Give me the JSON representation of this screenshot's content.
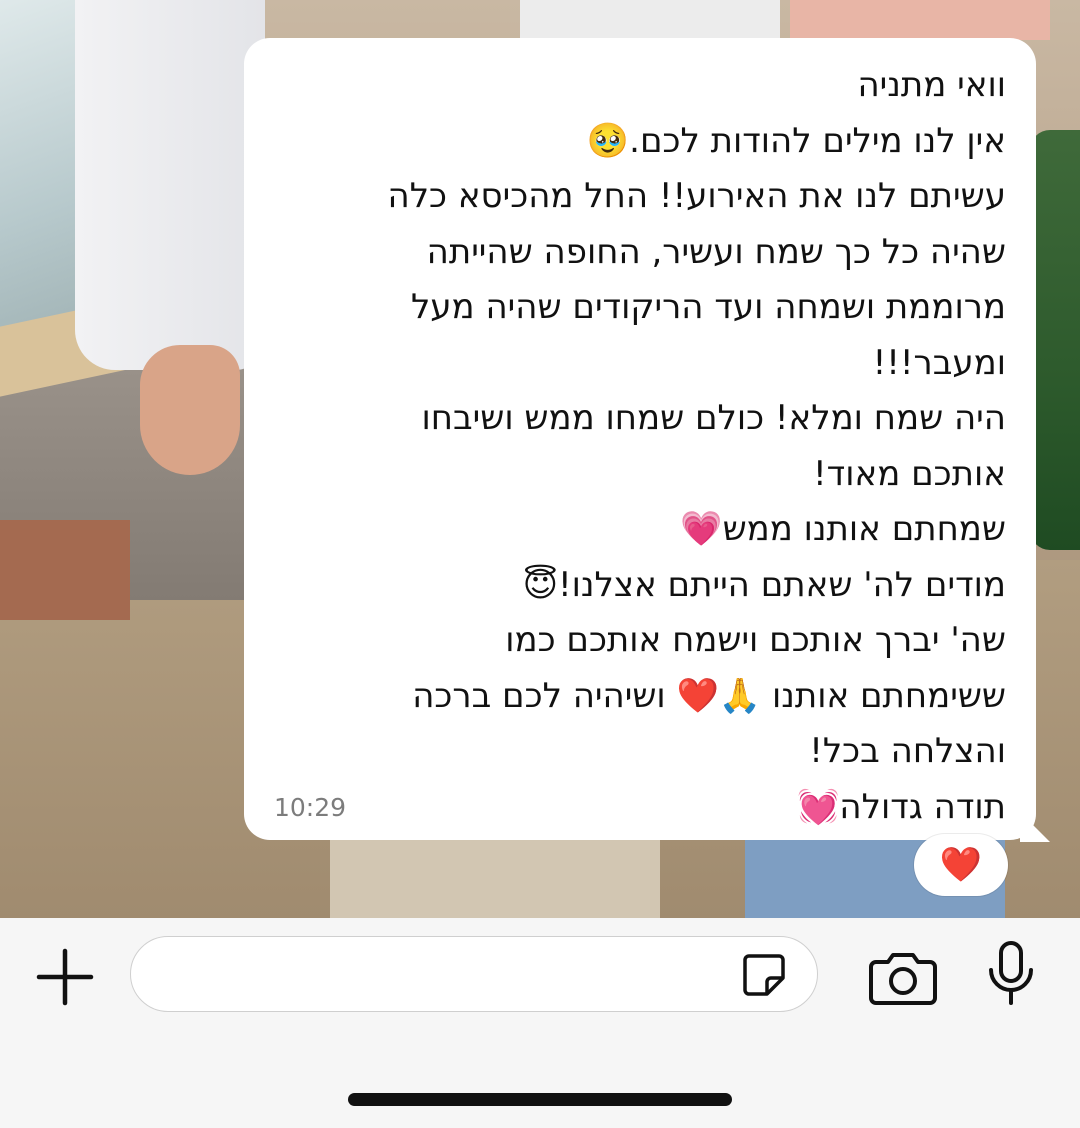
{
  "message": {
    "lines": [
      "וואי מתניה",
      "אין לנו מילים להודות לכם.🥹",
      "עשיתם לנו את האירוע!! החל מהכיסא כלה",
      "שהיה כל כך שמח ועשיר, החופה שהייתה",
      "מרוממת ושמחה ועד הריקודים שהיה מעל",
      "ומעבר!!!",
      "היה שמח ומלא! כולם שמחו ממש ושיבחו",
      "אותכם מאוד!",
      "שמחתם אותנו ממש💗",
      "מודים לה' שאתם הייתם אצלנו!😇",
      "שה' יברך אותכם וישמח אותכם כמו",
      "ששימחתם אותנו 🙏❤️ ושיהיה לכם ברכה",
      "והצלחה בכל!",
      "תודה גדולה💓"
    ],
    "time": "10:29"
  },
  "reaction": {
    "emoji": "❤️"
  },
  "composer": {
    "input_value": "",
    "icons": {
      "plus": "plus-icon",
      "sticker": "sticker-icon",
      "camera": "camera-icon",
      "mic": "microphone-icon"
    }
  },
  "colors": {
    "bubble": "#ffffff",
    "text": "#111111",
    "time": "#7c7c7c",
    "reaction_heart": "#e0162b",
    "composer_bg": "#f6f6f6"
  }
}
